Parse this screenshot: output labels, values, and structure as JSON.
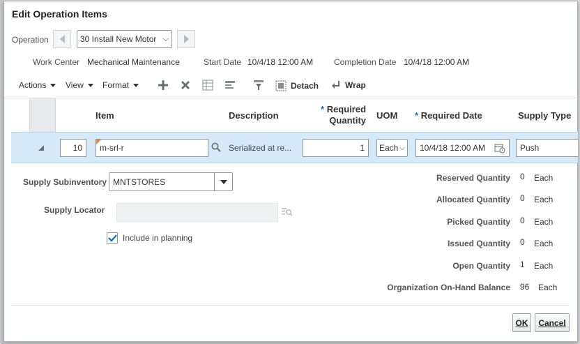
{
  "dialog": {
    "title": "Edit Operation Items"
  },
  "operation": {
    "label": "Operation",
    "value": "30 Install New Motor"
  },
  "info": {
    "work_center_label": "Work Center",
    "work_center_value": "Mechanical Maintenance",
    "start_date_label": "Start Date",
    "start_date_value": "10/4/18 12:00 AM",
    "completion_date_label": "Completion Date",
    "completion_date_value": "10/4/18 12:00 AM"
  },
  "toolbar": {
    "actions": "Actions",
    "view": "View",
    "format": "Format",
    "detach": "Detach",
    "wrap": "Wrap"
  },
  "table": {
    "headers": {
      "item": "Item",
      "description": "Description",
      "required": "Required",
      "quantity": "Quantity",
      "uom": "UOM",
      "required_date": "Required Date",
      "supply_type": "Supply Type"
    },
    "row": {
      "seq": "10",
      "item": "m-srl-r",
      "description": "Serialized at re...",
      "required_quantity": "1",
      "uom": "Each",
      "required_date": "10/4/18 12:00 AM",
      "supply_type": "Push"
    }
  },
  "detail": {
    "supply_subinventory_label": "Supply Subinventory",
    "supply_subinventory_value": "MNTSTORES",
    "supply_locator_label": "Supply Locator",
    "supply_locator_value": "",
    "include_in_planning_label": "Include in planning",
    "include_in_planning_checked": true,
    "quantities": [
      {
        "label": "Reserved Quantity",
        "value": "0",
        "unit": "Each"
      },
      {
        "label": "Allocated Quantity",
        "value": "0",
        "unit": "Each"
      },
      {
        "label": "Picked Quantity",
        "value": "0",
        "unit": "Each"
      },
      {
        "label": "Issued Quantity",
        "value": "0",
        "unit": "Each"
      },
      {
        "label": "Open Quantity",
        "value": "1",
        "unit": "Each"
      },
      {
        "label": "Organization On-Hand Balance",
        "value": "96",
        "unit": "Each"
      }
    ]
  },
  "buttons": {
    "ok": "OK",
    "cancel": "Cancel"
  },
  "colors": {
    "selected_row": "#d6e9f8",
    "required_star": "#0572ce",
    "check": "#0572ce"
  }
}
